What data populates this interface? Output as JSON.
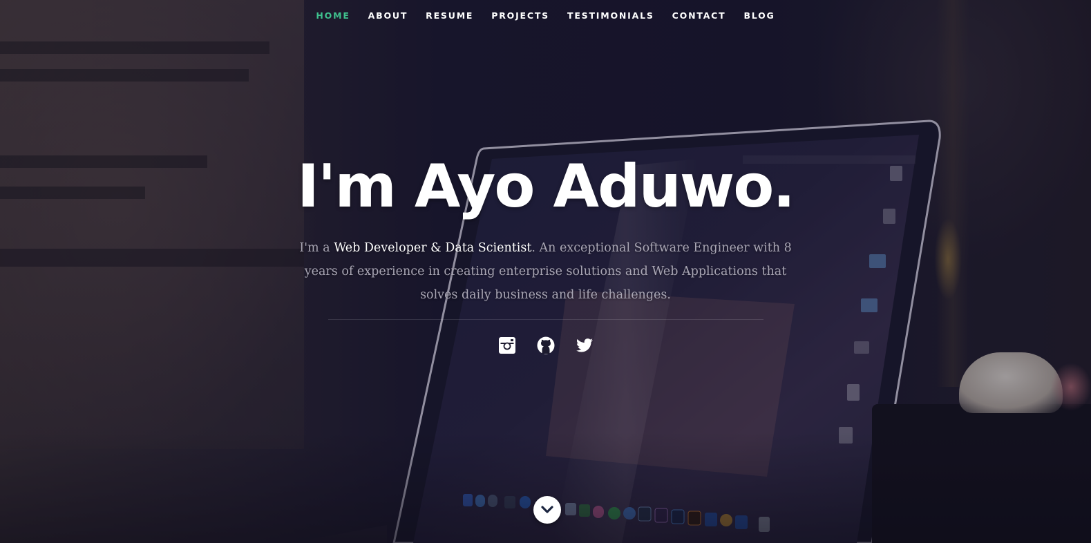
{
  "nav": {
    "items": [
      {
        "label": "HOME",
        "active": true
      },
      {
        "label": "ABOUT"
      },
      {
        "label": "RESUME"
      },
      {
        "label": "PROJECTS"
      },
      {
        "label": "TESTIMONIALS"
      },
      {
        "label": "CONTACT"
      },
      {
        "label": "BLOG"
      }
    ],
    "active_color": "#3fc28e"
  },
  "hero": {
    "title": "I'm Ayo Aduwo.",
    "desc_prefix": "I'm a ",
    "desc_highlight": "Web Developer & Data Scientist",
    "desc_rest": ". An exceptional Software Engineer with 8 years of experience in creating enterprise solutions and Web Applications that solves daily business and life challenges."
  },
  "social": {
    "icons": [
      "instagram-icon",
      "github-icon",
      "twitter-icon"
    ]
  },
  "scroll": {
    "icon": "chevron-down-icon"
  }
}
